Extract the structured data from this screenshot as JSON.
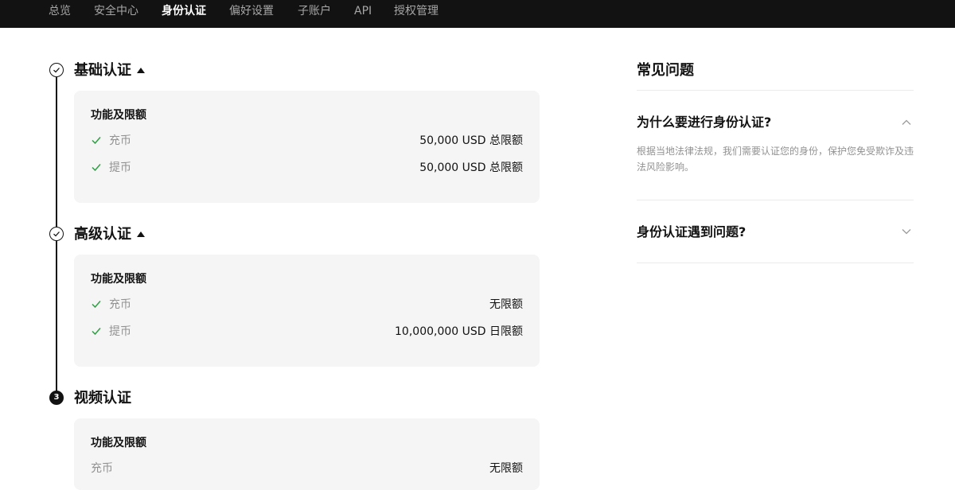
{
  "nav": {
    "items": [
      {
        "label": "总览"
      },
      {
        "label": "安全中心"
      },
      {
        "label": "身份认证"
      },
      {
        "label": "偏好设置"
      },
      {
        "label": "子账户"
      },
      {
        "label": "API"
      },
      {
        "label": "授权管理"
      }
    ],
    "active": "身份认证"
  },
  "sections": [
    {
      "title": "基础认证",
      "step": "",
      "status": "completed",
      "card_heading": "功能及限额",
      "rows": [
        {
          "label": "充币",
          "value": "50,000 USD 总限额"
        },
        {
          "label": "提币",
          "value": "50,000 USD 总限额"
        }
      ]
    },
    {
      "title": "高级认证",
      "step": "",
      "status": "completed",
      "card_heading": "功能及限额",
      "rows": [
        {
          "label": "充币",
          "value": "无限额"
        },
        {
          "label": "提币",
          "value": "10,000,000 USD 日限额"
        }
      ]
    },
    {
      "title": "视频认证",
      "step": "3",
      "status": "pending",
      "card_heading": "功能及限额",
      "rows": [
        {
          "label": "充币",
          "value": "无限额"
        }
      ]
    }
  ],
  "faq": {
    "title": "常见问题",
    "items": [
      {
        "question": "为什么要进行身份认证?",
        "expanded": true,
        "answer": "根据当地法律法规，我们需要认证您的身份，保护您免受欺诈及违法风险影响。"
      },
      {
        "question": "身份认证遇到问题?",
        "expanded": false,
        "answer": ""
      }
    ]
  },
  "colors": {
    "nav_bg": "#121212",
    "check_green": "#2ea044",
    "card_bg": "#f5f5f5",
    "muted_text": "#929292"
  },
  "icons": {
    "step_done": "check-circle-icon",
    "row_check": "check-icon",
    "collapse": "chevron-up-icon",
    "expand": "chevron-down-icon",
    "section_toggle": "caret-up-icon"
  }
}
